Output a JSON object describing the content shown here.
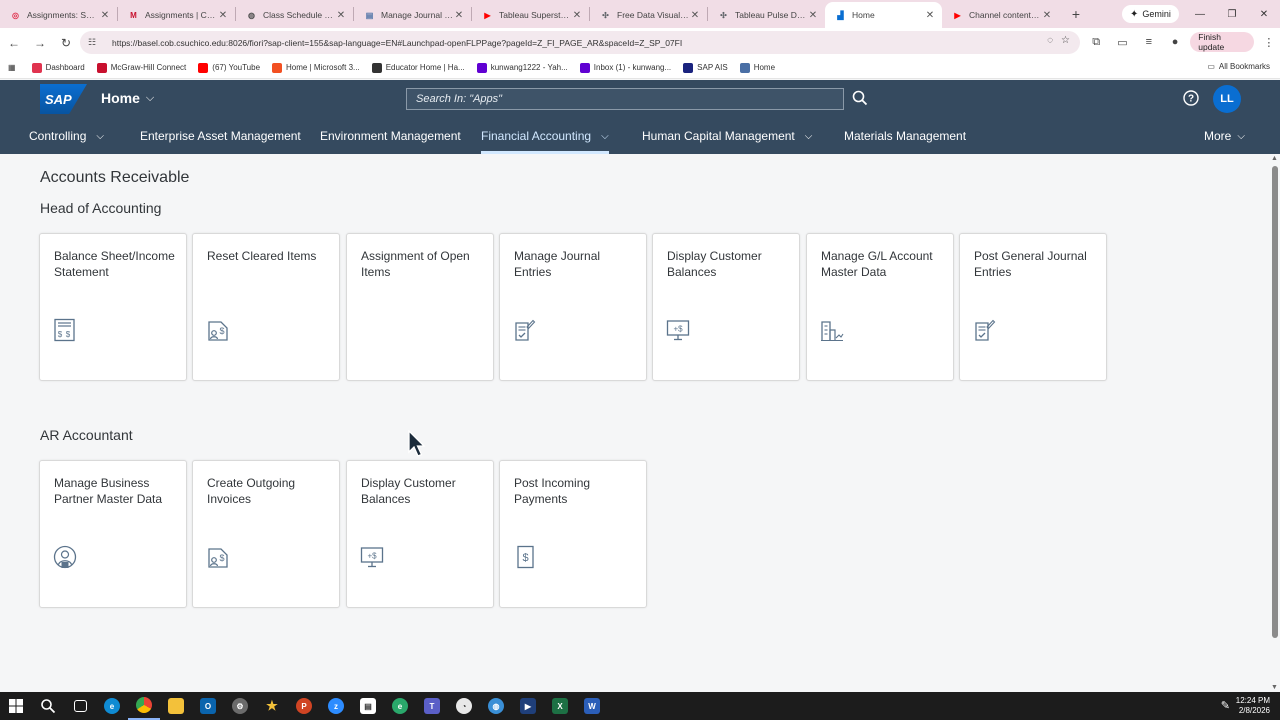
{
  "browser": {
    "tabs": [
      {
        "label": "Assignments: Spring",
        "icon": "canvas-icon",
        "color": "#e0334f",
        "active": false
      },
      {
        "label": "Assignments | Conn",
        "icon": "mcgraw-hill-icon",
        "color": "#c8102e",
        "active": false
      },
      {
        "label": "Class Schedule Listing",
        "icon": "globe-icon",
        "color": "#555555",
        "active": false
      },
      {
        "label": "Manage Journal Entries",
        "icon": "doc-icon",
        "color": "#4a6fa5",
        "active": false
      },
      {
        "label": "Tableau Superstore",
        "icon": "youtube-icon",
        "color": "#ff0000",
        "active": false
      },
      {
        "label": "Free Data Visualization",
        "icon": "tableau-icon",
        "color": "#5f6368",
        "active": false
      },
      {
        "label": "Tableau Pulse Demo",
        "icon": "tableau-icon",
        "color": "#5f6368",
        "active": false
      },
      {
        "label": "Home",
        "icon": "sap-tab-icon",
        "color": "#0a6ed1",
        "active": true
      },
      {
        "label": "Channel content - YouTube",
        "icon": "youtube-icon",
        "color": "#ff0000",
        "active": false
      }
    ],
    "gemini_label": "Gemini",
    "url": "https://basel.cob.csuchico.edu:8026/fiori?sap-client=155&sap-language=EN#Launchpad-openFLPPage?pageId=Z_FI_PAGE_AR&spaceId=Z_SP_07FI",
    "finish_update_label": "Finish update",
    "bookmarks": [
      {
        "label": "Dashboard",
        "color": "#e0334f"
      },
      {
        "label": "McGraw-Hill Connect",
        "color": "#c8102e"
      },
      {
        "label": "(67) YouTube",
        "color": "#ff0000"
      },
      {
        "label": "Home | Microsoft 3...",
        "color": "#f25022"
      },
      {
        "label": "Educator Home | Ha...",
        "color": "#333333"
      },
      {
        "label": "kunwang1222 - Yah...",
        "color": "#6001d2"
      },
      {
        "label": "Inbox (1) - kunwang...",
        "color": "#6001d2"
      },
      {
        "label": "SAP AIS",
        "color": "#1a237e"
      },
      {
        "label": "Home",
        "color": "#4a6fa5"
      }
    ],
    "all_bookmarks_label": "All Bookmarks"
  },
  "shell": {
    "logo_text": "SAP",
    "home_title": "Home",
    "search_placeholder": "Search In: \"Apps\"",
    "avatar_initials": "LL",
    "nav_items": [
      {
        "label": "Controlling",
        "has_menu": true,
        "selected": false
      },
      {
        "label": "Enterprise Asset Management",
        "has_menu": false,
        "selected": false
      },
      {
        "label": "Environment Management",
        "has_menu": false,
        "selected": false
      },
      {
        "label": "Financial Accounting",
        "has_menu": true,
        "selected": true
      },
      {
        "label": "Human Capital Management",
        "has_menu": true,
        "selected": false
      },
      {
        "label": "Materials Management",
        "has_menu": false,
        "selected": false
      }
    ],
    "more_label": "More"
  },
  "content": {
    "page_title": "Accounts Receivable",
    "sections": [
      {
        "title": "Head of Accounting",
        "tiles": [
          {
            "title": "Balance Sheet/Income Statement",
            "icon": "balance-sheet-icon"
          },
          {
            "title": "Reset Cleared Items",
            "icon": "document-dollar-icon"
          },
          {
            "title": "Assignment of Open Items",
            "icon": ""
          },
          {
            "title": "Manage Journal Entries",
            "icon": "journal-check-icon"
          },
          {
            "title": "Display Customer Balances",
            "icon": "monitor-dollar-icon"
          },
          {
            "title": "Manage G/L Account Master Data",
            "icon": "gl-account-icon"
          },
          {
            "title": "Post General Journal Entries",
            "icon": "journal-check-icon"
          }
        ]
      },
      {
        "title": "AR Accountant",
        "tiles": [
          {
            "title": "Manage Business Partner Master Data",
            "icon": "business-partner-icon"
          },
          {
            "title": "Create Outgoing Invoices",
            "icon": "document-dollar-icon"
          },
          {
            "title": "Display Customer Balances",
            "icon": "monitor-dollar-icon"
          },
          {
            "title": "Post Incoming Payments",
            "icon": "payment-dollar-icon"
          }
        ]
      }
    ]
  },
  "taskbar": {
    "time": "12:24 PM",
    "date": "2/8/2026"
  },
  "colors": {
    "shell_bg": "#354a5f",
    "accent": "#0a6ed1",
    "selected_nav": "#d1e8ff",
    "icon_color": "#5b738b"
  }
}
